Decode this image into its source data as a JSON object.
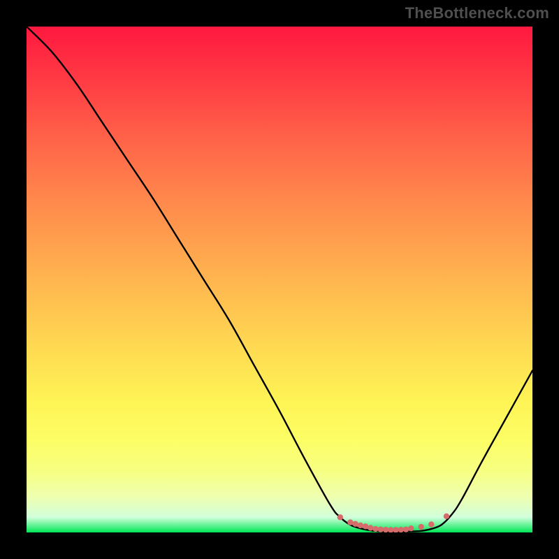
{
  "watermark": {
    "text": "TheBottleneck.com"
  },
  "chart_data": {
    "type": "line",
    "title": "",
    "xlabel": "",
    "ylabel": "",
    "xlim": [
      0,
      100
    ],
    "ylim": [
      0,
      100
    ],
    "series": [
      {
        "name": "main-curve",
        "x": [
          0,
          5,
          10,
          15,
          20,
          25,
          30,
          35,
          40,
          45,
          50,
          55,
          60,
          62,
          64,
          66,
          68,
          70,
          72,
          74,
          76,
          78,
          80,
          82,
          84,
          86,
          90,
          95,
          100
        ],
        "values": [
          100,
          95,
          88.5,
          81,
          73.5,
          66,
          58,
          50,
          42,
          33,
          24,
          14.5,
          5.5,
          3,
          1.5,
          0.8,
          0.4,
          0.2,
          0.15,
          0.15,
          0.2,
          0.3,
          0.7,
          1.5,
          3.5,
          6.5,
          14,
          23,
          32
        ]
      }
    ],
    "markers": {
      "name": "bottom-dots",
      "color": "#d66b6b",
      "x": [
        62,
        64,
        65,
        66,
        67,
        68,
        69,
        70,
        71,
        72,
        73,
        74,
        75,
        76,
        78,
        80,
        83
      ],
      "values": [
        3,
        2,
        1.7,
        1.4,
        1.2,
        0.9,
        0.7,
        0.6,
        0.55,
        0.5,
        0.5,
        0.55,
        0.6,
        0.8,
        1.1,
        1.6,
        3.2
      ]
    },
    "gradient_stops": [
      {
        "pos": 0,
        "color": "#ff183f"
      },
      {
        "pos": 10,
        "color": "#ff3944"
      },
      {
        "pos": 22,
        "color": "#ff6248"
      },
      {
        "pos": 35,
        "color": "#ff8a4c"
      },
      {
        "pos": 50,
        "color": "#ffb54f"
      },
      {
        "pos": 64,
        "color": "#ffdb52"
      },
      {
        "pos": 74,
        "color": "#fef455"
      },
      {
        "pos": 82,
        "color": "#fcfe66"
      },
      {
        "pos": 88,
        "color": "#f7ff83"
      },
      {
        "pos": 93,
        "color": "#eeffb0"
      },
      {
        "pos": 97,
        "color": "#d1ffdb"
      },
      {
        "pos": 100,
        "color": "#00e756"
      }
    ]
  }
}
